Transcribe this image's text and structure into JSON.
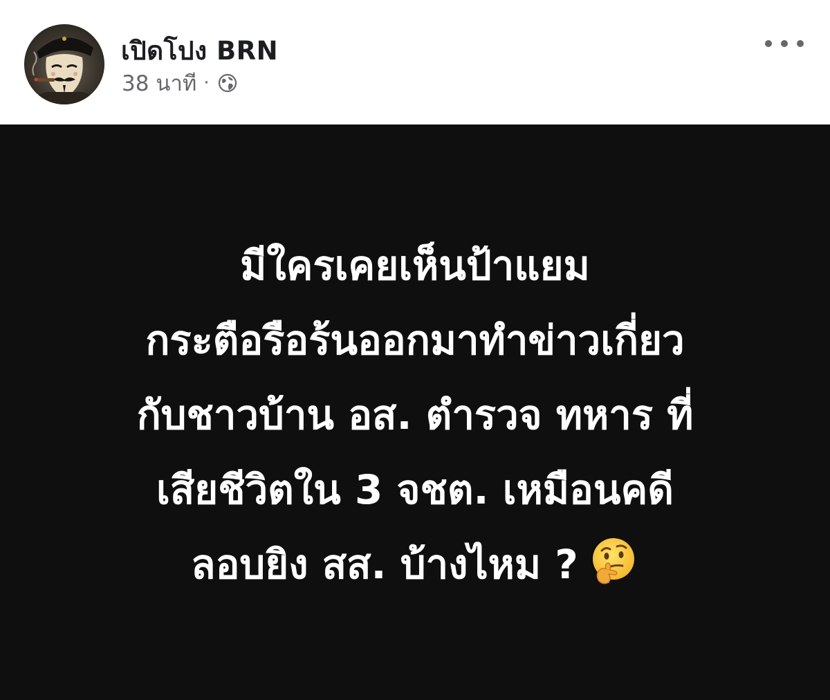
{
  "post": {
    "author_name": "เปิดโปง BRN",
    "timestamp": "38 นาที",
    "separator": "·",
    "privacy_icon": "globe-icon",
    "more_icon": "more-horizontal-icon"
  },
  "image_text": {
    "lines": [
      "มีใครเคยเห็นป้าแยม",
      "กระตือรือร้นออกมาทำข่าวเกี่ยว",
      "กับชาวบ้าน อส. ตำรวจ ทหาร ที่",
      "เสียชีวิตใน 3 จชต. เหมือนคดี",
      "ลอบยิง สส. บ้างไหม ?"
    ],
    "trailing_emoji": "thinking-face-emoji"
  },
  "colors": {
    "image_background": "#0f0f0f",
    "image_text": "#ffffff",
    "name_text": "#1c1e21",
    "meta_text": "#65676b"
  }
}
